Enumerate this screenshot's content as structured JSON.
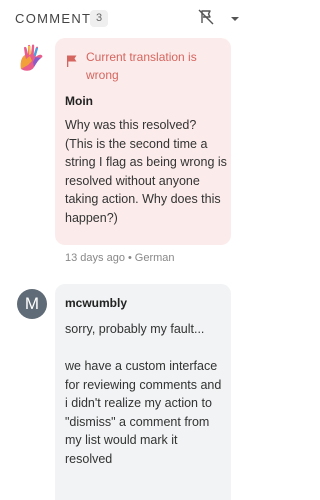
{
  "header": {
    "title": "COMMENTS",
    "count": "3",
    "icons": [
      "flag-off-icon",
      "chevron-down-icon"
    ]
  },
  "comments": [
    {
      "avatar": "hand-logo-avatar",
      "flag_label": "Current translation is wrong",
      "author": "Moin",
      "text": "Why was this resolved? (This is the second time a string I flag as being wrong is resolved without anyone taking action. Why does this happen?)",
      "time": "13 days ago",
      "separator": "•",
      "language": "German",
      "colors": {
        "bubble": "#fbeceb",
        "flag": "#d5655f"
      }
    },
    {
      "avatar_letter": "M",
      "author": "mcwumbly",
      "text": "sorry, probably my fault...\n\nwe have a custom interface for reviewing comments and i didn't realize my action to \"dismiss\" a comment from my list would mark it resolved",
      "colors": {
        "bubble": "#f1f3f4",
        "avatar": "#5f6b76"
      }
    }
  ]
}
